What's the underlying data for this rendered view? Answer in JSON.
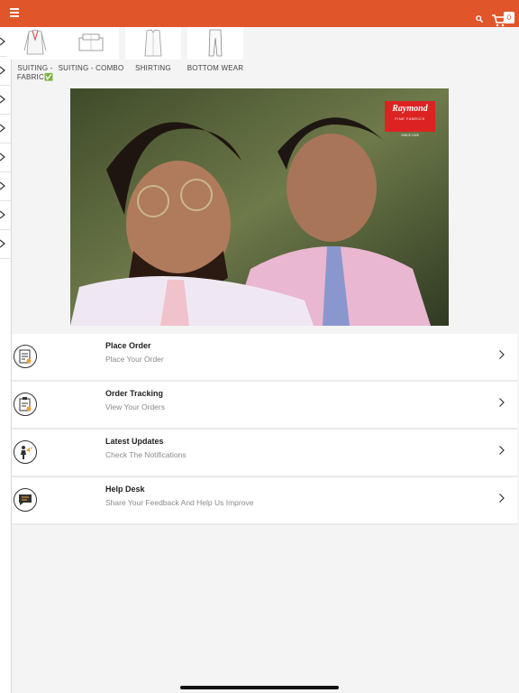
{
  "header": {
    "cart_count": "0",
    "accent_color": "#e0562a",
    "icons": [
      "menu-icon",
      "search-icon",
      "cart-icon"
    ]
  },
  "categories": [
    {
      "label": "SUITING - FABRIC✅",
      "icon": "jacket-icon"
    },
    {
      "label": "SUITING - COMBO",
      "icon": "folded-shirt-icon"
    },
    {
      "label": "SHIRTING",
      "icon": "shirt-icon"
    },
    {
      "label": "BOTTOM WEAR",
      "icon": "trousers-icon"
    }
  ],
  "banner": {
    "brand": "Raymond",
    "tagline": "FINE FABRICS",
    "since": "SINCE 1925"
  },
  "menu": [
    {
      "title": "Place Order",
      "subtitle": "Place Your Order",
      "icon": "checklist-icon"
    },
    {
      "title": "Order Tracking",
      "subtitle": "View Your Orders",
      "icon": "clipboard-icon"
    },
    {
      "title": "Latest Updates",
      "subtitle": "Check The Notifications",
      "icon": "announcer-icon"
    },
    {
      "title": "Help Desk",
      "subtitle": "Share Your Feedback And Help Us Improve",
      "icon": "chat-icon"
    }
  ]
}
